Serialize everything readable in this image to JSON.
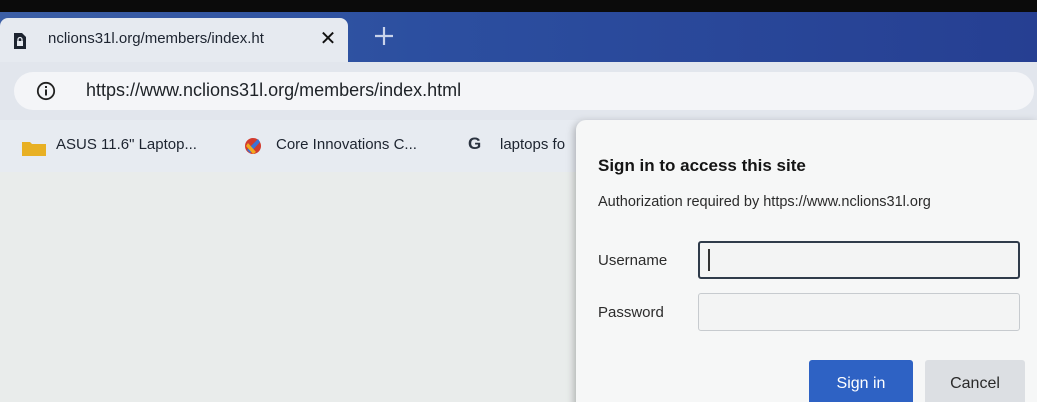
{
  "tab": {
    "title": "nclions31l.org/members/index.ht",
    "close_glyph": "✕",
    "favicon": "page-lock-icon"
  },
  "toolbar": {
    "url": "https://www.nclions31l.org/members/index.html",
    "info_icon": "info-icon"
  },
  "bookmarks": [
    {
      "label": "ASUS 11.6\" Laptop...",
      "icon": "folder-icon"
    },
    {
      "label": "Core Innovations C...",
      "icon": "core-innovations-icon"
    },
    {
      "label": "laptops fo",
      "icon": "google-g-icon"
    }
  ],
  "dialog": {
    "title": "Sign in to access this site",
    "subtitle": "Authorization required by https://www.nclions31l.org",
    "username_label": "Username",
    "password_label": "Password",
    "username_value": "",
    "password_value": "",
    "signin_label": "Sign in",
    "cancel_label": "Cancel"
  },
  "colors": {
    "tabstrip": "#2c4fa0",
    "primary_button": "#2e62c4",
    "secondary_button": "#dcdfe3"
  }
}
